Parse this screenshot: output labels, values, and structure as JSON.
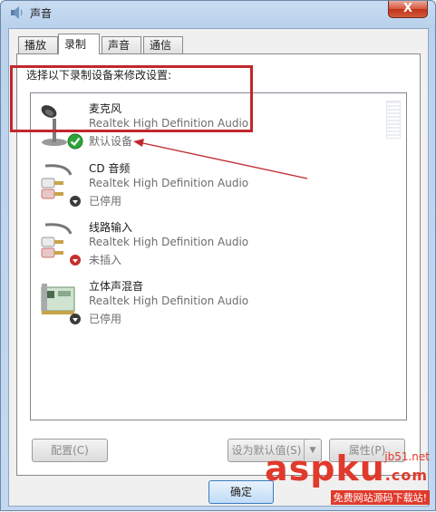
{
  "window": {
    "title": "声音",
    "close_label": "X"
  },
  "tabs": [
    {
      "label": "播放",
      "active": false
    },
    {
      "label": "录制",
      "active": true
    },
    {
      "label": "声音",
      "active": false
    },
    {
      "label": "通信",
      "active": false
    }
  ],
  "instruction": "选择以下录制设备来修改设置:",
  "devices": [
    {
      "name": "麦克风",
      "driver": "Realtek High Definition Audio",
      "status": "默认设备",
      "icon": "microphone-icon",
      "badge": "default-check-icon"
    },
    {
      "name": "CD 音频",
      "driver": "Realtek High Definition Audio",
      "status": "已停用",
      "icon": "audio-cable-icon",
      "badge": "disabled-down-icon"
    },
    {
      "name": "线路输入",
      "driver": "Realtek High Definition Audio",
      "status": "未插入",
      "icon": "audio-cable-icon",
      "badge": "unplugged-down-icon"
    },
    {
      "name": "立体声混音",
      "driver": "Realtek High Definition Audio",
      "status": "已停用",
      "icon": "sound-card-icon",
      "badge": "disabled-down-icon"
    }
  ],
  "buttons": {
    "configure": "配置(C)",
    "set_default": "设为默认值(S)",
    "properties": "属性(P)",
    "ok": "确定"
  },
  "watermark": {
    "brand": "aspku",
    "suffix": ".com",
    "domain": "jb51.net",
    "tagline": "免费网站源码下载站!"
  },
  "colors": {
    "highlight": "#c0282d",
    "accent": "#3b7bbf",
    "check": "#2ea53a"
  }
}
